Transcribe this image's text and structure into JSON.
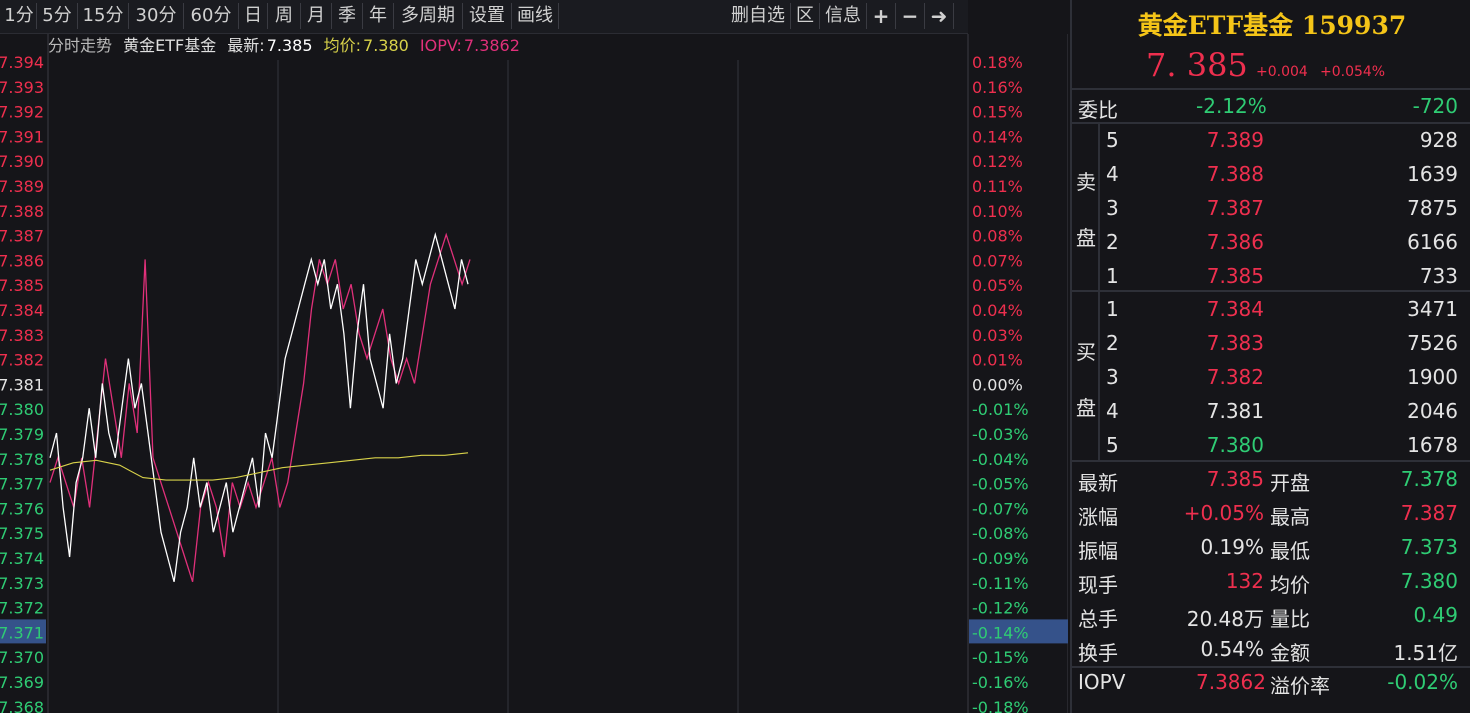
{
  "toolbar": {
    "periods": [
      "1分",
      "5分",
      "15分",
      "30分",
      "60分",
      "日",
      "周",
      "月",
      "季",
      "年",
      "多周期",
      "设置",
      "画线"
    ],
    "right_items": [
      "删自选",
      "区",
      "信息",
      "+",
      "−",
      "➜"
    ]
  },
  "chart": {
    "label": "分时走势",
    "name": "黄金ETF基金",
    "latest_label": "最新:",
    "latest_value": "7.385",
    "avg_label": "均价:",
    "avg_value": "7.380",
    "iopv_label": "IOPV:",
    "iopv_value": "7.3862",
    "hover_price": "7.371",
    "hover_pct": "-0.14%"
  },
  "chart_data": {
    "type": "line",
    "y_ticks": [
      "7.394",
      "7.393",
      "7.392",
      "7.391",
      "7.390",
      "7.389",
      "7.388",
      "7.387",
      "7.386",
      "7.385",
      "7.384",
      "7.383",
      "7.382",
      "7.381",
      "7.380",
      "7.379",
      "7.378",
      "7.377",
      "7.376",
      "7.375",
      "7.374",
      "7.373",
      "7.372",
      "7.371",
      "7.370",
      "7.369",
      "7.368"
    ],
    "pct_ticks": [
      "0.18%",
      "0.16%",
      "0.15%",
      "0.14%",
      "0.12%",
      "0.11%",
      "0.10%",
      "0.08%",
      "0.07%",
      "0.05%",
      "0.04%",
      "0.03%",
      "0.01%",
      "0.00%",
      "-0.01%",
      "-0.03%",
      "-0.04%",
      "-0.05%",
      "-0.07%",
      "-0.08%",
      "-0.09%",
      "-0.11%",
      "-0.12%",
      "-0.14%",
      "-0.15%",
      "-0.16%",
      "-0.18%"
    ],
    "ylim": [
      7.368,
      7.394
    ],
    "prev_close": 7.381,
    "series": [
      {
        "values": [
          7.378,
          7.379,
          7.376,
          7.374,
          7.377,
          7.378,
          7.38,
          7.378,
          7.381,
          7.379,
          7.378,
          7.38,
          7.382,
          7.38,
          7.381,
          7.379,
          7.377,
          7.375,
          7.374,
          7.373,
          7.375,
          7.376,
          7.378,
          7.376,
          7.377,
          7.375,
          7.376,
          7.377,
          7.375,
          7.376,
          7.377,
          7.378,
          7.376,
          7.379,
          7.378,
          7.38,
          7.382,
          7.383,
          7.384,
          7.385,
          7.386,
          7.385,
          7.386,
          7.384,
          7.385,
          7.383,
          7.38,
          7.383,
          7.385,
          7.382,
          7.381,
          7.38,
          7.383,
          7.381,
          7.382,
          7.384,
          7.386,
          7.385,
          7.386,
          7.387,
          7.386,
          7.385,
          7.384,
          7.386,
          7.385
        ]
      },
      {
        "values": [
          7.377,
          7.378,
          7.377,
          7.376,
          7.378,
          7.376,
          7.379,
          7.382,
          7.38,
          7.378,
          7.381,
          7.379,
          7.386,
          7.378,
          7.377,
          7.376,
          7.375,
          7.374,
          7.373,
          7.376,
          7.377,
          7.376,
          7.374,
          7.377,
          7.376,
          7.377,
          7.376,
          7.377,
          7.378,
          7.376,
          7.377,
          7.379,
          7.381,
          7.384,
          7.386,
          7.385,
          7.386,
          7.384,
          7.385,
          7.383,
          7.382,
          7.383,
          7.384,
          7.382,
          7.381,
          7.382,
          7.381,
          7.383,
          7.385,
          7.386,
          7.387,
          7.386,
          7.385,
          7.386
        ]
      },
      {
        "values": [
          7.3775,
          7.3778,
          7.3779,
          7.3777,
          7.3772,
          7.3771,
          7.3771,
          7.3771,
          7.3772,
          7.3774,
          7.3776,
          7.3777,
          7.3778,
          7.3779,
          7.378,
          7.378,
          7.3781,
          7.3781,
          7.3782
        ]
      }
    ]
  },
  "quote": {
    "title": "黄金ETF基金 159937",
    "price": "7. 385",
    "change": "+0.004",
    "change_pct": "+0.054%",
    "weibi_label": "委比",
    "weibi_pct": "-2.12%",
    "weibi_diff": "-720",
    "sell_label_1": "卖",
    "sell_label_2": "盘",
    "buy_label_1": "买",
    "buy_label_2": "盘",
    "sell": [
      {
        "level": "5",
        "price": "7.389",
        "vol": "928"
      },
      {
        "level": "4",
        "price": "7.388",
        "vol": "1639"
      },
      {
        "level": "3",
        "price": "7.387",
        "vol": "7875"
      },
      {
        "level": "2",
        "price": "7.386",
        "vol": "6166"
      },
      {
        "level": "1",
        "price": "7.385",
        "vol": "733"
      }
    ],
    "buy": [
      {
        "level": "1",
        "price": "7.384",
        "vol": "3471"
      },
      {
        "level": "2",
        "price": "7.383",
        "vol": "7526"
      },
      {
        "level": "3",
        "price": "7.382",
        "vol": "1900"
      },
      {
        "level": "4",
        "price": "7.381",
        "vol": "2046"
      },
      {
        "level": "5",
        "price": "7.380",
        "vol": "1678"
      }
    ],
    "stats": [
      {
        "l1": "最新",
        "v1": "7.385",
        "l2": "开盘",
        "v2": "7.378"
      },
      {
        "l1": "涨幅",
        "v1": "+0.05%",
        "l2": "最高",
        "v2": "7.387"
      },
      {
        "l1": "振幅",
        "v1": "0.19%",
        "l2": "最低",
        "v2": "7.373"
      },
      {
        "l1": "现手",
        "v1": "132",
        "l2": "均价",
        "v2": "7.380"
      },
      {
        "l1": "总手",
        "v1": "20.48万",
        "l2": "量比",
        "v2": "0.49"
      },
      {
        "l1": "换手",
        "v1": "0.54%",
        "l2": "金额",
        "v2": "1.51亿"
      }
    ],
    "iopv_label": "IOPV",
    "iopv_value": "7.3862",
    "premium_label": "溢价率",
    "premium_value": "-0.02%"
  },
  "colors": {
    "up": "#ee2f4e",
    "down": "#2fcc74",
    "price_line": "#ffffff",
    "iopv_line": "#e0307a",
    "avg_line": "#d8d24a",
    "title": "#f5c518"
  }
}
